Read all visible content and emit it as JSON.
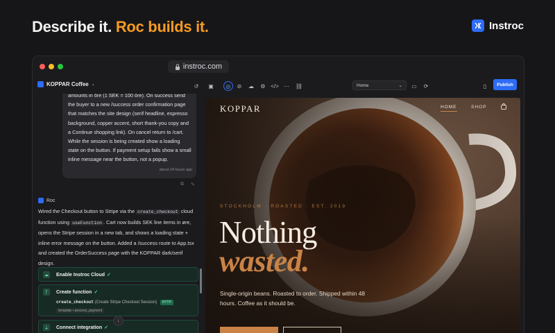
{
  "headline": {
    "part1": "Describe it.",
    "part2": "Roc builds it."
  },
  "brand": {
    "name": "Instroc",
    "accent": "#2d6cf6"
  },
  "browser": {
    "url": "instroc.com",
    "traffic_colors": [
      "#ff5f57",
      "#febc2e",
      "#28c840"
    ]
  },
  "toolbar": {
    "project_name": "KOPPAR Coffee",
    "page_select": "Home",
    "publish_label": "Publish",
    "icons": [
      "history-icon",
      "layout-icon",
      "globe-icon",
      "compass-icon",
      "cloud-icon",
      "gear-icon",
      "code-icon",
      "more-icon",
      "link-icon",
      "device-desktop-icon",
      "refresh-icon",
      "device-phone-icon"
    ]
  },
  "chat": {
    "user_message": {
      "text": "amounts in öre (1 SEK = 100 öre). On success send the buyer to a new /success order confirmation page that matches the site design (serif headline, espresso background, copper accent, short thank-you copy and a Continue shopping link). On cancel return to /cart. While the session is being created show a loading state on the button. If payment setup fails show a small inline message near the button, not a popup.",
      "time": "about 24 hours ago"
    },
    "assistant": {
      "name": "Roc",
      "text_1": "Wired the Checkout button to Stripe via the",
      "code_1": "create_checkout",
      "text_2": "cloud function using",
      "code_2": "useFunction",
      "text_3": ". Cart now builds SEK line items in øre, opens the Stripe session in a new tab, and shows a loading state + inline error message on the button. Added a /success route to App.tsx and created the OrderSuccess page with the KOPPAR dark/serif design."
    },
    "steps": [
      {
        "title": "Enable Instroc Cloud"
      },
      {
        "title": "Create function",
        "function_name": "create_checkout",
        "function_desc": "(Create Stripe Checkout Session)",
        "badge": "HTTP",
        "template": "template • process_payment"
      },
      {
        "title": "Connect integration"
      }
    ]
  },
  "preview": {
    "logo": "KOPPAR",
    "nav": [
      "HOME",
      "SHOP"
    ],
    "eyebrow": "STOCKHOLM · ROASTED · EST. 2019",
    "headline_1": "Nothing",
    "headline_2": "wasted.",
    "subtext": "Single-origin beans. Roasted to order. Shipped within 48 hours. Coffee as it should be.",
    "accent": "#c98346"
  }
}
